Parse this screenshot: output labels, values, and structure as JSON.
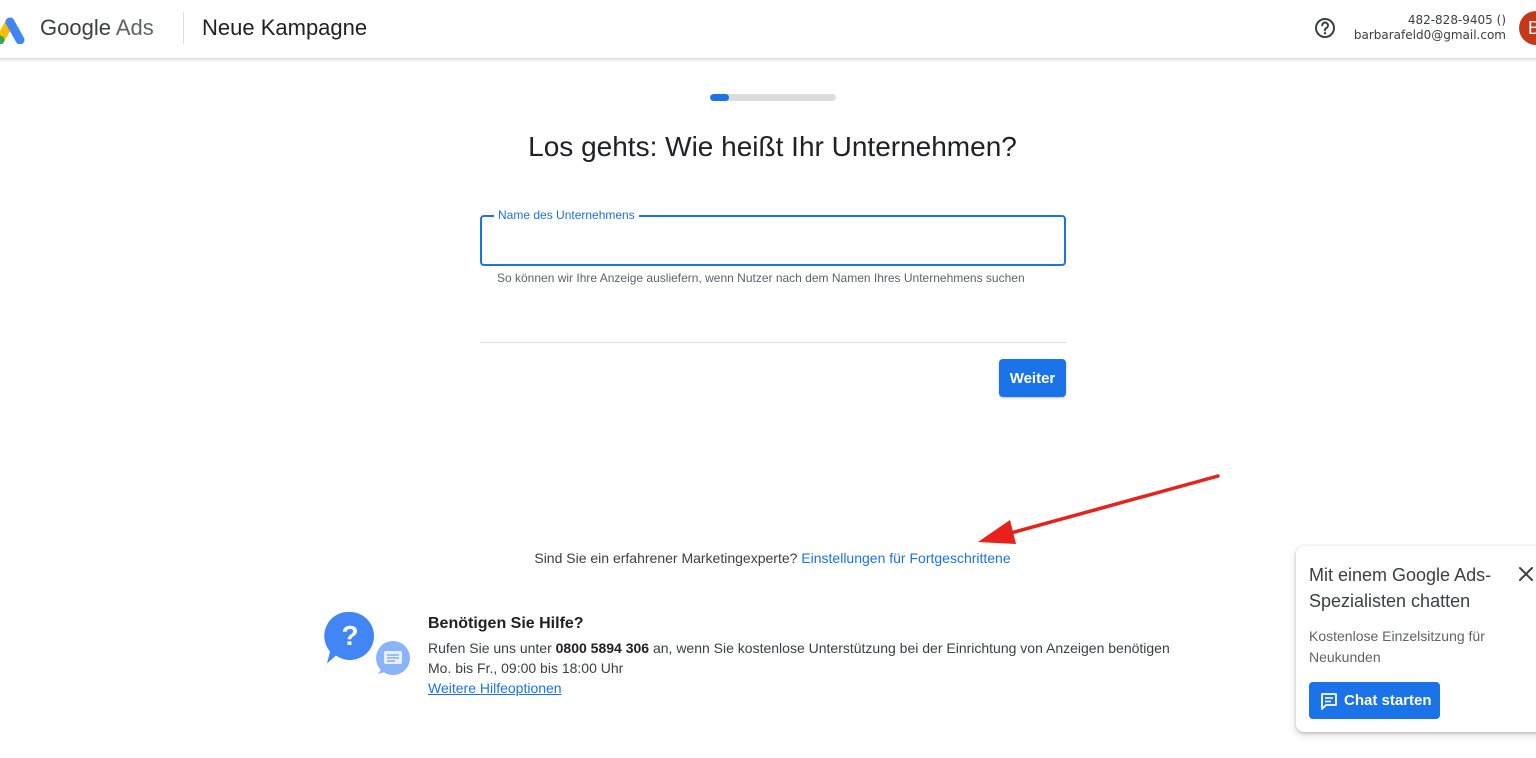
{
  "header": {
    "brand_google": "Google",
    "brand_ads": "Ads",
    "title": "Neue Kampagne",
    "account_id": "482-828-9405 ()",
    "account_email": "barbarafeld0@gmail.com",
    "avatar_initial": "B"
  },
  "progress": {
    "value_percent": 15
  },
  "main": {
    "title": "Los gehts: Wie heißt Ihr Unternehmen?",
    "field_label": "Name des Unternehmens",
    "field_value": "",
    "field_hint": "So können wir Ihre Anzeige ausliefern, wenn Nutzer nach dem Namen Ihres Unternehmens suchen",
    "next_button": "Weiter"
  },
  "advanced": {
    "question": "Sind Sie ein erfahrener Marketingexperte?",
    "link": "Einstellungen für Fortgeschrittene"
  },
  "help": {
    "title": "Benötigen Sie Hilfe?",
    "text_before": "Rufen Sie uns unter",
    "phone": "0800 5894 306",
    "text_after": "an, wenn Sie kostenlose Unterstützung bei der Einrichtung von Anzeigen benötigen",
    "hours": "Mo. bis Fr., 09:00 bis 18:00 Uhr",
    "more_link": "Weitere Hilfeoptionen"
  },
  "chat": {
    "title": "Mit einem Google Ads-Spezialisten chatten",
    "description": "Kostenlose Einzelsitzung für Neukunden",
    "button": "Chat starten"
  },
  "colors": {
    "accent": "#1a73e8",
    "annotation_arrow": "#e8211b",
    "avatar": "#c5391b"
  }
}
